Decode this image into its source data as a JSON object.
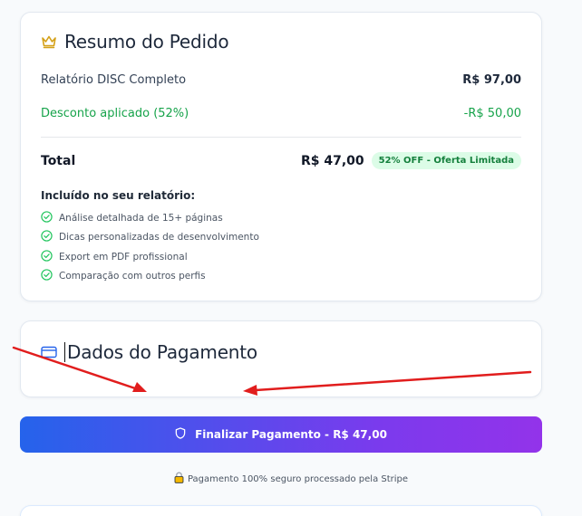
{
  "summary": {
    "title": "Resumo do Pedido",
    "icon": "crown-icon",
    "item_label": "Relatório DISC Completo",
    "item_price": "R$ 97,00",
    "discount_label": "Desconto aplicado (52%)",
    "discount_value": "-R$ 50,00",
    "total_label": "Total",
    "total_amount": "R$ 47,00",
    "badge": "52% OFF - Oferta Limitada",
    "included_title": "Incluído no seu relatório:",
    "features": [
      "Análise detalhada de 15+ páginas",
      "Dicas personalizadas de desenvolvimento",
      "Export em PDF profissional",
      "Comparação com outros perfis"
    ]
  },
  "payment": {
    "title": "Dados do Pagamento",
    "icon": "credit-card-icon"
  },
  "pay_button": {
    "label": "Finalizar Pagamento - R$ 47,00",
    "icon": "shield-icon"
  },
  "secure_note": {
    "text": "Pagamento 100% seguro processado pela Stripe",
    "icon": "lock-icon"
  },
  "colors": {
    "accent_green": "#16a34a",
    "gradient_start": "#2563eb",
    "gradient_end": "#9333ea",
    "annotation_red": "#e11d1d"
  }
}
